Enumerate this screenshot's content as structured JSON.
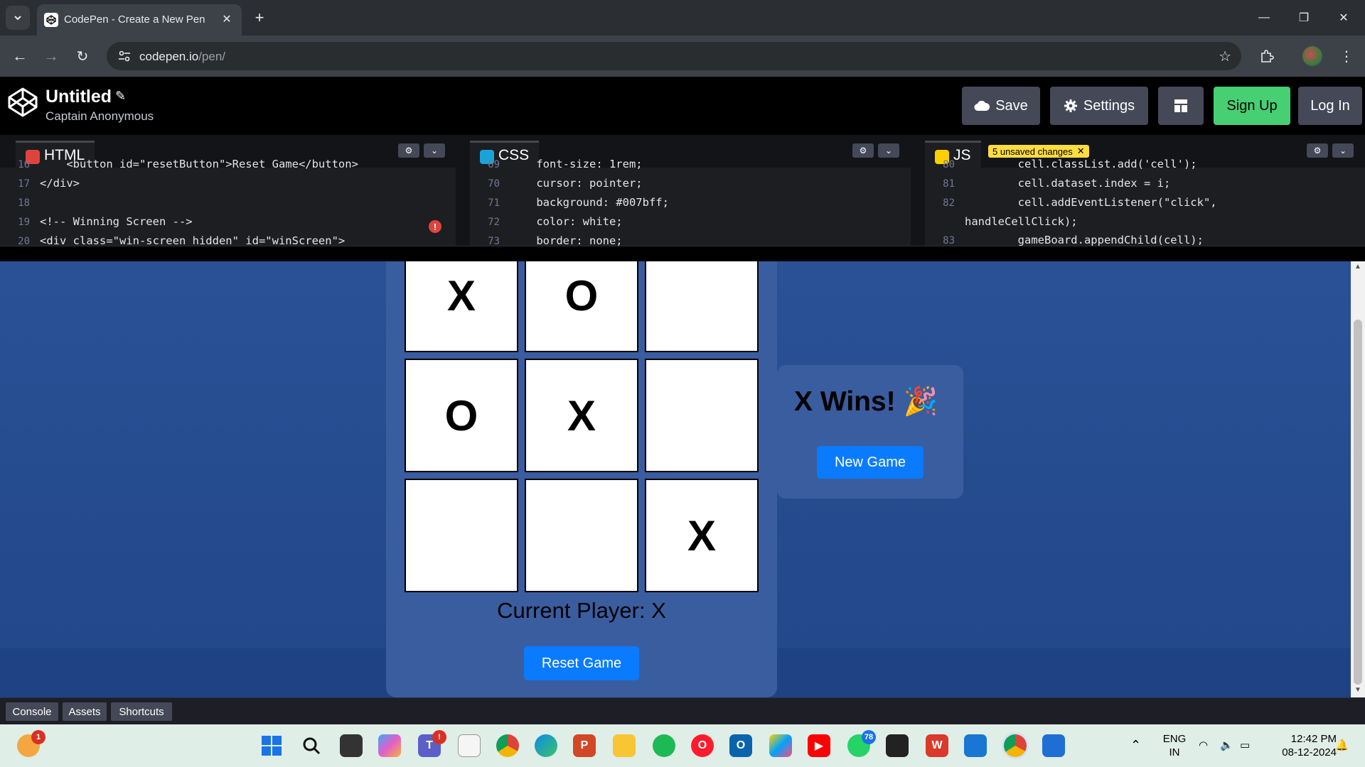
{
  "browser": {
    "tab_title": "CodePen - Create a New Pen",
    "url_host": "codepen.io",
    "url_path": "/pen/"
  },
  "codepen": {
    "title": "Untitled",
    "author": "Captain Anonymous",
    "buttons": {
      "save": "Save",
      "settings": "Settings",
      "signup": "Sign Up",
      "login": "Log In"
    }
  },
  "editors": {
    "html": {
      "label": "HTML",
      "lines": [
        {
          "n": "16",
          "code": "    <button id=\"resetButton\">Reset Game</button>"
        },
        {
          "n": "17",
          "code": "</div>"
        },
        {
          "n": "18",
          "code": ""
        },
        {
          "n": "19",
          "code": "<!-- Winning Screen -->"
        },
        {
          "n": "20",
          "code": "<div class=\"win-screen hidden\" id=\"winScreen\">"
        }
      ]
    },
    "css": {
      "label": "CSS",
      "lines": [
        {
          "n": "69",
          "code": "    font-size: 1rem;"
        },
        {
          "n": "70",
          "code": "    cursor: pointer;"
        },
        {
          "n": "71",
          "code": "    background: #007bff;"
        },
        {
          "n": "72",
          "code": "    color: white;"
        },
        {
          "n": "73",
          "code": "    border: none;"
        }
      ]
    },
    "js": {
      "label": "JS",
      "unsaved": "5 unsaved changes",
      "lines": [
        {
          "n": "80",
          "code": "        cell.classList.add('cell');"
        },
        {
          "n": "81",
          "code": "        cell.dataset.index = i;"
        },
        {
          "n": "82",
          "code": "        cell.addEventListener(\"click\","
        },
        {
          "n": "",
          "code": "handleCellClick);"
        },
        {
          "n": "83",
          "code": "        gameBoard.appendChild(cell);"
        }
      ]
    }
  },
  "game": {
    "board": [
      "X",
      "O",
      "",
      "O",
      "X",
      "",
      "",
      "",
      "X"
    ],
    "current_player": "Current Player: X",
    "reset_label": "Reset Game",
    "win_text": "X Wins! 🎉",
    "new_game_label": "New Game"
  },
  "footer": {
    "console": "Console",
    "assets": "Assets",
    "shortcuts": "Shortcuts"
  },
  "taskbar": {
    "lang_line1": "ENG",
    "lang_line2": "IN",
    "time": "12:42 PM",
    "date": "08-12-2024",
    "whatsapp_badge": "78",
    "weather_badge": "1",
    "teams_badge": "!"
  },
  "colors": {
    "codepen_green": "#47cf73",
    "button_blue": "#0a7bff",
    "preview_bg": "#2a5196",
    "unsaved_yellow": "#ffdd40"
  }
}
